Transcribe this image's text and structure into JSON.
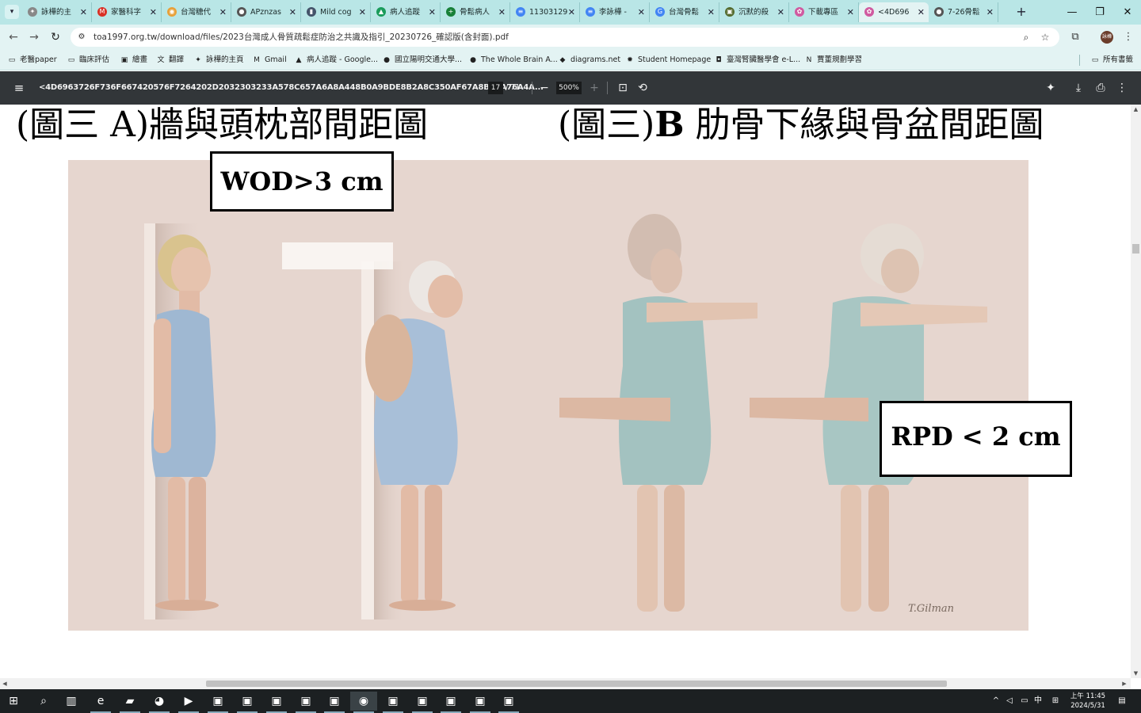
{
  "browser": {
    "tabs": [
      {
        "label": "詠樺的主",
        "icon": "sparkle-icon",
        "color": "#888888"
      },
      {
        "label": "家醫科字",
        "icon": "gmail-icon",
        "color": "#d93025"
      },
      {
        "label": "台灣糖代",
        "icon": "chrome-icon",
        "color": "#e8a13a"
      },
      {
        "label": "APznzas",
        "icon": "globe-icon",
        "color": "#555555"
      },
      {
        "label": "Mild cog",
        "icon": "bookmark-icon",
        "color": "#44546a"
      },
      {
        "label": "病人追蹤",
        "icon": "drive-icon",
        "color": "#1a9c5b"
      },
      {
        "label": "骨鬆病人",
        "icon": "sheets-plus-icon",
        "color": "#188038"
      },
      {
        "label": "11303129",
        "icon": "docs-icon",
        "color": "#4285f4"
      },
      {
        "label": "李詠樺 -",
        "icon": "docs-icon",
        "color": "#4285f4"
      },
      {
        "label": "台灣骨鬆",
        "icon": "google-icon",
        "color": "#4285f4"
      },
      {
        "label": "沉默的殺",
        "icon": "image-icon",
        "color": "#556b2f"
      },
      {
        "label": "下載專區",
        "icon": "flower-icon",
        "color": "#d05aa0"
      },
      {
        "label": "<4D696",
        "icon": "flower-icon",
        "color": "#d05aa0",
        "active": true
      },
      {
        "label": "7-26骨鬆",
        "icon": "globe-icon",
        "color": "#555555"
      }
    ],
    "new_tab_label": "+",
    "url": "toa1997.org.tw/download/files/2023台灣成人骨質疏鬆症防治之共識及指引_20230726_確認版(含封面).pdf",
    "avatar_text": "詠樺",
    "bookmarks": [
      {
        "label": "老醫paper",
        "icon": "folder-icon"
      },
      {
        "label": "臨床評估",
        "icon": "folder-icon"
      },
      {
        "label": "繪畫",
        "icon": "image-icon"
      },
      {
        "label": "翻譯",
        "icon": "translate-icon"
      },
      {
        "label": "詠樺的主頁",
        "icon": "sparkle-icon"
      },
      {
        "label": "Gmail",
        "icon": "gmail-icon"
      },
      {
        "label": "病人追蹤 - Google...",
        "icon": "drive-icon"
      },
      {
        "label": "國立陽明交通大學...",
        "icon": "globe-icon"
      },
      {
        "label": "The Whole Brain A...",
        "icon": "globe-icon"
      },
      {
        "label": "diagrams.net",
        "icon": "diagrams-icon"
      },
      {
        "label": "Student Homepage",
        "icon": "gear-icon"
      },
      {
        "label": "臺灣腎臟醫學會 e-L...",
        "icon": "badge-icon"
      },
      {
        "label": "賈董規劃學習",
        "icon": "notion-icon"
      }
    ],
    "all_bookmarks_label": "所有書籤"
  },
  "pdf": {
    "title": "<4D6963726F736F667420576F7264202D2032303233A578C657A6A8A448B0A9BDE8B2A8C350AF67A8BEAA76A4A...",
    "page_current": "17",
    "page_total": "/ 71",
    "zoom": "500%",
    "heading_left": "(圖三 A)牆與頭枕部間距圖",
    "heading_right_prefix": "(圖三)",
    "heading_right_bold": "B",
    "heading_right_suffix": "肋骨下緣與骨盆間距圖",
    "label_wod": "WOD>3 cm",
    "label_rpd": "RPD < 2 cm",
    "signature": "T.Gilman"
  },
  "taskbar": {
    "apps": [
      "windows-start-icon",
      "search-icon",
      "task-view-icon",
      "edge-icon",
      "file-explorer-icon",
      "copilot-icon",
      "youtube-icon",
      "app-icon",
      "app-icon",
      "app-icon",
      "app-icon",
      "app-icon",
      "chrome-icon",
      "app-icon",
      "app-icon",
      "app-icon",
      "app-icon",
      "app-icon"
    ],
    "ime": "中",
    "time": "上午 11:45",
    "date": "2024/5/31"
  },
  "colors": {
    "tabstrip": "#b9e6e6",
    "toolbar": "#e3f3f3",
    "pdfbar": "#323639",
    "figure_bg": "#e6d6cf"
  }
}
